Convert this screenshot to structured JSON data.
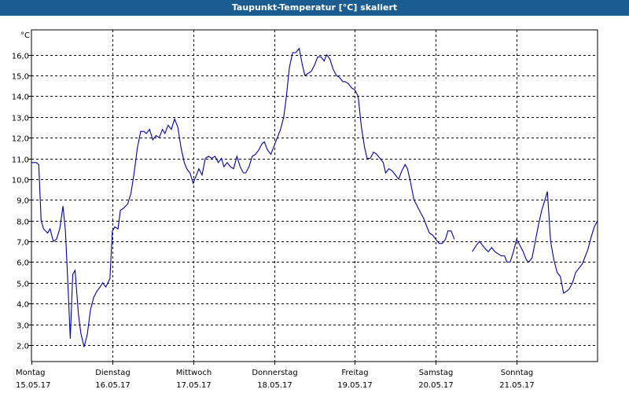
{
  "window": {
    "title": "Taupunkt-Temperatur [°C] skaliert"
  },
  "colors": {
    "title_bg": "#1c5d91",
    "line": "#0000aa",
    "grid": "#000000",
    "axis": "#000000"
  },
  "chart_data": {
    "type": "line",
    "title": "Taupunkt-Temperatur [°C] skaliert",
    "ylabel": "°C",
    "xlabel": "",
    "ylim": [
      1.2,
      17.2
    ],
    "y_ticks": [
      "2,0",
      "3,0",
      "4,0",
      "5,0",
      "6,0",
      "7,0",
      "8,0",
      "9,0",
      "10,0",
      "11,0",
      "12,0",
      "13,0",
      "14,0",
      "15,0",
      "16,0"
    ],
    "xlim": [
      0,
      7
    ],
    "x_ticks": [
      {
        "day": "Montag",
        "date": "15.05.17"
      },
      {
        "day": "Dienstag",
        "date": "16.05.17"
      },
      {
        "day": "Mittwoch",
        "date": "17.05.17"
      },
      {
        "day": "Donnerstag",
        "date": "18.05.17"
      },
      {
        "day": "Freitag",
        "date": "19.05.17"
      },
      {
        "day": "Samstag",
        "date": "20.05.17"
      },
      {
        "day": "Sonntag",
        "date": "21.05.17"
      }
    ],
    "grid": true,
    "series": [
      {
        "segments": [
          [
            [
              0.0,
              10.8
            ],
            [
              0.06,
              10.8
            ],
            [
              0.09,
              10.7
            ],
            [
              0.12,
              8.0
            ],
            [
              0.15,
              7.6
            ],
            [
              0.2,
              7.4
            ],
            [
              0.23,
              7.6
            ],
            [
              0.27,
              7.0
            ],
            [
              0.31,
              7.1
            ],
            [
              0.35,
              7.6
            ],
            [
              0.39,
              8.7
            ],
            [
              0.42,
              7.5
            ],
            [
              0.45,
              5.0
            ],
            [
              0.48,
              2.3
            ],
            [
              0.51,
              5.4
            ],
            [
              0.54,
              5.6
            ],
            [
              0.58,
              3.5
            ],
            [
              0.61,
              2.6
            ],
            [
              0.65,
              1.9
            ],
            [
              0.69,
              2.5
            ],
            [
              0.73,
              3.7
            ],
            [
              0.77,
              4.3
            ],
            [
              0.81,
              4.6
            ],
            [
              0.85,
              4.8
            ],
            [
              0.88,
              5.0
            ],
            [
              0.92,
              4.8
            ],
            [
              0.97,
              5.2
            ],
            [
              1.0,
              7.5
            ],
            [
              1.03,
              7.7
            ],
            [
              1.07,
              7.6
            ],
            [
              1.1,
              8.5
            ],
            [
              1.14,
              8.6
            ],
            [
              1.19,
              8.8
            ],
            [
              1.23,
              9.3
            ],
            [
              1.27,
              10.3
            ],
            [
              1.31,
              11.5
            ],
            [
              1.35,
              12.3
            ],
            [
              1.39,
              12.3
            ],
            [
              1.42,
              12.2
            ],
            [
              1.46,
              12.4
            ],
            [
              1.5,
              11.9
            ],
            [
              1.54,
              12.1
            ],
            [
              1.58,
              12.0
            ],
            [
              1.62,
              12.4
            ],
            [
              1.65,
              12.2
            ],
            [
              1.69,
              12.6
            ],
            [
              1.73,
              12.4
            ],
            [
              1.77,
              12.9
            ],
            [
              1.81,
              12.5
            ],
            [
              1.85,
              11.5
            ],
            [
              1.89,
              10.8
            ],
            [
              1.92,
              10.5
            ],
            [
              1.96,
              10.3
            ],
            [
              2.0,
              9.8
            ],
            [
              2.03,
              10.1
            ],
            [
              2.07,
              10.5
            ],
            [
              2.11,
              10.2
            ],
            [
              2.15,
              11.0
            ],
            [
              2.19,
              11.1
            ],
            [
              2.23,
              11.0
            ],
            [
              2.27,
              11.1
            ],
            [
              2.31,
              10.8
            ],
            [
              2.35,
              11.0
            ],
            [
              2.38,
              10.6
            ],
            [
              2.42,
              10.8
            ],
            [
              2.46,
              10.6
            ],
            [
              2.5,
              10.5
            ],
            [
              2.54,
              11.1
            ],
            [
              2.58,
              10.6
            ],
            [
              2.62,
              10.3
            ],
            [
              2.65,
              10.3
            ],
            [
              2.69,
              10.6
            ],
            [
              2.73,
              11.1
            ],
            [
              2.77,
              11.2
            ],
            [
              2.81,
              11.4
            ],
            [
              2.85,
              11.7
            ],
            [
              2.88,
              11.8
            ],
            [
              2.92,
              11.4
            ],
            [
              2.96,
              11.2
            ],
            [
              3.0,
              11.6
            ],
            [
              3.04,
              12.0
            ],
            [
              3.08,
              12.4
            ],
            [
              3.12,
              13.0
            ],
            [
              3.15,
              13.9
            ],
            [
              3.19,
              15.4
            ],
            [
              3.23,
              16.1
            ],
            [
              3.27,
              16.1
            ],
            [
              3.31,
              16.3
            ],
            [
              3.35,
              15.5
            ],
            [
              3.38,
              15.0
            ],
            [
              3.42,
              15.1
            ],
            [
              3.46,
              15.2
            ],
            [
              3.5,
              15.5
            ],
            [
              3.54,
              15.9
            ],
            [
              3.58,
              15.9
            ],
            [
              3.62,
              15.7
            ],
            [
              3.65,
              16.0
            ],
            [
              3.69,
              15.8
            ],
            [
              3.73,
              15.3
            ],
            [
              3.77,
              15.0
            ],
            [
              3.81,
              14.9
            ],
            [
              3.85,
              14.7
            ],
            [
              3.88,
              14.7
            ],
            [
              3.92,
              14.6
            ],
            [
              3.96,
              14.4
            ],
            [
              4.0,
              14.3
            ],
            [
              4.04,
              14.0
            ],
            [
              4.08,
              12.5
            ],
            [
              4.12,
              11.5
            ],
            [
              4.15,
              11.0
            ],
            [
              4.19,
              11.0
            ],
            [
              4.23,
              11.3
            ],
            [
              4.27,
              11.2
            ],
            [
              4.31,
              11.0
            ],
            [
              4.35,
              10.8
            ],
            [
              4.38,
              10.3
            ],
            [
              4.42,
              10.5
            ],
            [
              4.46,
              10.4
            ],
            [
              4.5,
              10.2
            ],
            [
              4.54,
              10.0
            ],
            [
              4.58,
              10.4
            ],
            [
              4.62,
              10.7
            ],
            [
              4.65,
              10.5
            ],
            [
              4.69,
              9.8
            ],
            [
              4.73,
              9.0
            ],
            [
              4.77,
              8.7
            ],
            [
              4.81,
              8.4
            ],
            [
              4.85,
              8.1
            ],
            [
              4.88,
              7.8
            ],
            [
              4.92,
              7.4
            ],
            [
              4.96,
              7.3
            ],
            [
              5.0,
              7.1
            ],
            [
              5.04,
              6.9
            ],
            [
              5.08,
              6.9
            ],
            [
              5.12,
              7.1
            ],
            [
              5.15,
              7.5
            ],
            [
              5.19,
              7.5
            ],
            [
              5.23,
              7.1
            ]
          ],
          [
            [
              5.45,
              6.5
            ],
            [
              5.5,
              6.8
            ],
            [
              5.54,
              7.0
            ],
            [
              5.58,
              6.8
            ],
            [
              5.62,
              6.6
            ],
            [
              5.65,
              6.5
            ],
            [
              5.69,
              6.7
            ],
            [
              5.73,
              6.5
            ],
            [
              5.77,
              6.4
            ],
            [
              5.81,
              6.3
            ],
            [
              5.85,
              6.3
            ],
            [
              5.88,
              6.0
            ],
            [
              5.92,
              6.0
            ],
            [
              5.96,
              6.5
            ],
            [
              6.0,
              7.1
            ],
            [
              6.04,
              6.8
            ],
            [
              6.08,
              6.5
            ],
            [
              6.12,
              6.1
            ],
            [
              6.15,
              6.0
            ],
            [
              6.19,
              6.2
            ],
            [
              6.23,
              7.0
            ],
            [
              6.27,
              7.8
            ],
            [
              6.31,
              8.5
            ],
            [
              6.35,
              9.0
            ],
            [
              6.38,
              9.4
            ],
            [
              6.42,
              7.0
            ],
            [
              6.46,
              6.1
            ],
            [
              6.5,
              5.5
            ],
            [
              6.54,
              5.3
            ],
            [
              6.58,
              4.5
            ],
            [
              6.62,
              4.6
            ],
            [
              6.65,
              4.7
            ],
            [
              6.69,
              5.0
            ],
            [
              6.73,
              5.5
            ],
            [
              6.77,
              5.7
            ],
            [
              6.81,
              5.9
            ],
            [
              6.85,
              6.3
            ],
            [
              6.88,
              6.6
            ],
            [
              6.92,
              7.2
            ],
            [
              6.96,
              7.7
            ],
            [
              7.0,
              8.0
            ]
          ]
        ]
      }
    ]
  }
}
